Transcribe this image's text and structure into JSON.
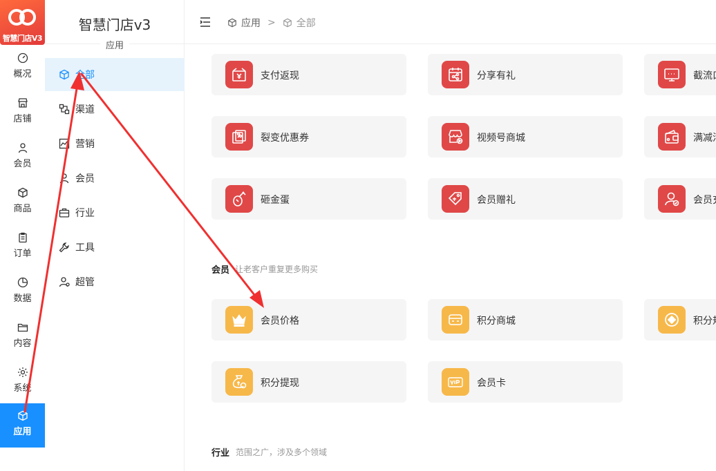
{
  "logo": {
    "text": "智慧门店V3"
  },
  "rail": {
    "items": [
      {
        "label": "概况",
        "icon": "dashboard-icon"
      },
      {
        "label": "店铺",
        "icon": "store-icon"
      },
      {
        "label": "会员",
        "icon": "user-icon"
      },
      {
        "label": "商品",
        "icon": "cube-icon"
      },
      {
        "label": "订单",
        "icon": "clipboard-icon"
      },
      {
        "label": "数据",
        "icon": "pie-chart-icon"
      },
      {
        "label": "内容",
        "icon": "folder-icon"
      },
      {
        "label": "系统",
        "icon": "gear-icon"
      },
      {
        "label": "应用",
        "icon": "cube-icon",
        "active": true
      }
    ]
  },
  "side": {
    "brand": "智慧门店v3",
    "section": "应用",
    "items": [
      {
        "label": "全部",
        "icon": "cube-icon",
        "active": true
      },
      {
        "label": "渠道",
        "icon": "channel-icon"
      },
      {
        "label": "营销",
        "icon": "marketing-chart-icon"
      },
      {
        "label": "会员",
        "icon": "user-icon"
      },
      {
        "label": "行业",
        "icon": "briefcase-icon"
      },
      {
        "label": "工具",
        "icon": "wrench-icon"
      },
      {
        "label": "超管",
        "icon": "admin-icon"
      }
    ]
  },
  "header": {
    "breadcrumb": [
      "应用",
      "全部"
    ],
    "separator": ">"
  },
  "marketing_cards": [
    {
      "label": "支付返现",
      "icon": "cash-gift-icon",
      "color": "#e04848"
    },
    {
      "label": "分享有礼",
      "icon": "share-gift-icon",
      "color": "#e04848"
    },
    {
      "label": "截流口",
      "icon": "screen-icon",
      "color": "#e04848"
    },
    {
      "label": "裂变优惠券",
      "icon": "coupon-icon",
      "color": "#e04848"
    },
    {
      "label": "视频号商城",
      "icon": "video-shop-icon",
      "color": "#e04848"
    },
    {
      "label": "满减活",
      "icon": "wallet-icon",
      "color": "#e04848"
    },
    {
      "label": "砸金蛋",
      "icon": "golden-egg-icon",
      "color": "#e04848"
    },
    {
      "label": "会员赠礼",
      "icon": "gift-tag-icon",
      "color": "#e04848"
    },
    {
      "label": "会员充",
      "icon": "member-recharge-icon",
      "color": "#e04848"
    }
  ],
  "member_section": {
    "title": "会员",
    "desc": "让老客户重复更多购买"
  },
  "member_cards": [
    {
      "label": "会员价格",
      "icon": "crown-icon",
      "color": "#f7b84a"
    },
    {
      "label": "积分商城",
      "icon": "points-shop-icon",
      "color": "#f7b84a"
    },
    {
      "label": "积分规",
      "icon": "points-rule-icon",
      "color": "#f7b84a"
    },
    {
      "label": "积分提现",
      "icon": "points-withdraw-icon",
      "color": "#f7b84a"
    },
    {
      "label": "会员卡",
      "icon": "vip-card-icon",
      "color": "#f7b84a"
    }
  ],
  "industry_section": {
    "title": "行业",
    "desc": "范围之广，涉及多个领域"
  },
  "colors": {
    "accent": "#1890ff",
    "red": "#e04848",
    "yellow": "#f7b84a",
    "arrow": "#f03030"
  }
}
